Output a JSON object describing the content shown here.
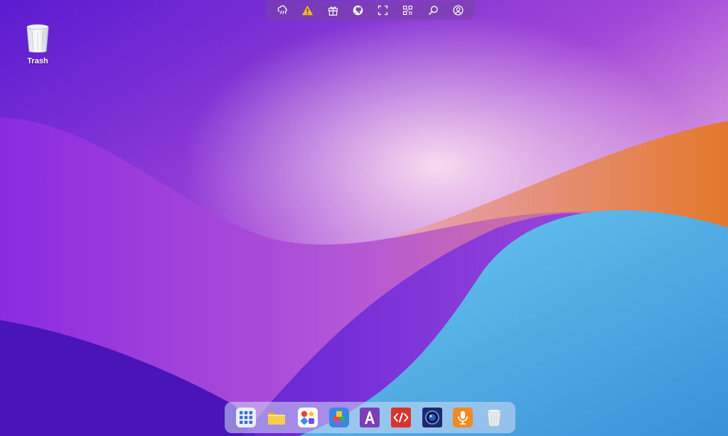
{
  "wallpaper": {
    "colors": {
      "deep_purple": "#5a1bd0",
      "violet": "#9b3ee0",
      "pink_glow": "#f1c8e6",
      "orange": "#e8873a",
      "sky_blue": "#5ec4ee",
      "navy": "#3a1aa8"
    }
  },
  "desktop_icons": [
    {
      "label": "Trash",
      "icon": "trash-icon"
    }
  ],
  "topbar": {
    "items": [
      {
        "name": "cloud-icon"
      },
      {
        "name": "warning-icon",
        "color": "#f2b829"
      },
      {
        "name": "gift-icon"
      },
      {
        "name": "github-icon"
      },
      {
        "name": "fullscreen-icon"
      },
      {
        "name": "qr-code-icon"
      },
      {
        "name": "search-icon"
      },
      {
        "name": "account-icon"
      }
    ]
  },
  "dock": {
    "items": [
      {
        "name": "launchpad-icon",
        "color": "#3f6bd9"
      },
      {
        "name": "folder-icon",
        "color": "#f5c341"
      },
      {
        "name": "app-store-icon",
        "color": "#ffffff"
      },
      {
        "name": "blocks-app-icon",
        "color": "#4a8de8"
      },
      {
        "name": "font-app-icon",
        "color": "#7b3fb8"
      },
      {
        "name": "code-editor-icon",
        "color": "#d8342c"
      },
      {
        "name": "camera-app-icon",
        "color": "#1d2b6e"
      },
      {
        "name": "voice-memo-icon",
        "color": "#f08a24"
      },
      {
        "name": "trash-icon",
        "color": "#e8ecef"
      }
    ]
  }
}
